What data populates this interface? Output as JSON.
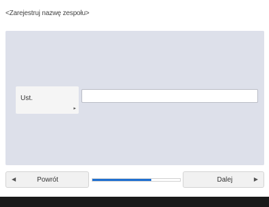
{
  "title": "<Zarejestruj nazwę zespołu>",
  "field": {
    "label": "Ust.",
    "value": ""
  },
  "navigation": {
    "back_label": "Powrót",
    "next_label": "Dalej",
    "back_icon": "triangle-left-icon",
    "next_icon": "triangle-right-icon"
  },
  "progress": {
    "fraction": 0.67
  },
  "colors": {
    "panel": "#dde0ea",
    "progress": "#1e6fd1",
    "footer": "#1a1a1a"
  }
}
